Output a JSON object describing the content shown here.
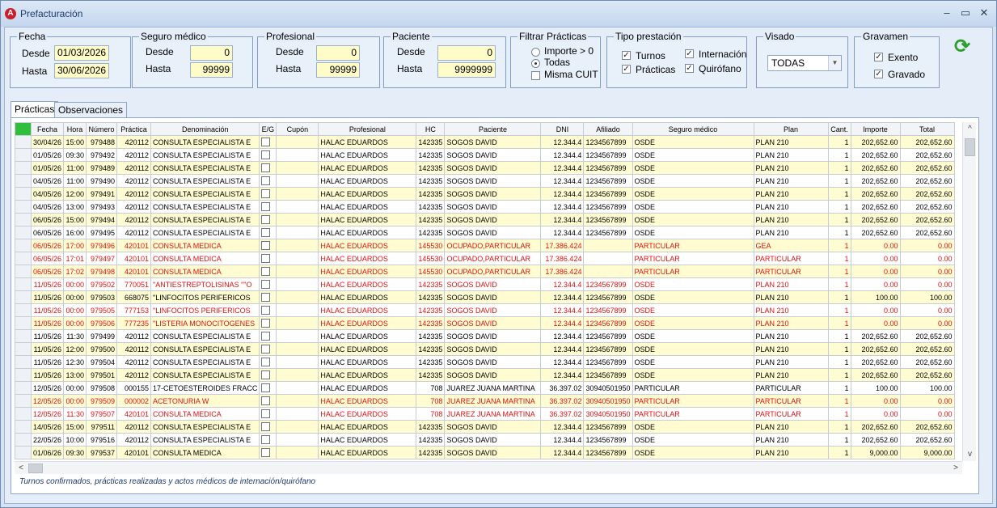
{
  "window": {
    "title": "Prefacturación",
    "minimize": "–",
    "maximize": "▭",
    "close": "✕"
  },
  "filters": {
    "fecha": {
      "label": "Fecha",
      "desde_label": "Desde",
      "desde": "01/03/2026",
      "hasta_label": "Hasta",
      "hasta": "30/06/2026"
    },
    "seguro": {
      "label": "Seguro médico",
      "desde_label": "Desde",
      "desde": "0",
      "hasta_label": "Hasta",
      "hasta": "99999"
    },
    "profesional": {
      "label": "Profesional",
      "desde_label": "Desde",
      "desde": "0",
      "hasta_label": "Hasta",
      "hasta": "99999"
    },
    "paciente": {
      "label": "Paciente",
      "desde_label": "Desde",
      "desde": "0",
      "hasta_label": "Hasta",
      "hasta": "9999999"
    },
    "practicas": {
      "label": "Filtrar Prácticas",
      "importe": "Importe > 0",
      "todas": "Todas",
      "misma_cuit": "Misma CUIT"
    },
    "tipo": {
      "label": "Tipo prestación",
      "turnos": "Turnos",
      "practicas": "Prácticas",
      "internacion": "Internación",
      "quirofano": "Quirófano"
    },
    "visado": {
      "label": "Visado",
      "value": "TODAS"
    },
    "gravamen": {
      "label": "Gravamen",
      "exento": "Exento",
      "gravado": "Gravado"
    }
  },
  "tabs": [
    {
      "label": "Prácticas"
    },
    {
      "label": "Observaciones"
    }
  ],
  "columns": [
    "Fecha",
    "Hora",
    "Número",
    "Práctica",
    "Denominación",
    "E/G",
    "Cupón",
    "Profesional",
    "HC",
    "Paciente",
    "DNI",
    "Afiliado",
    "Seguro médico",
    "Plan",
    "Cant.",
    "Importe",
    "Total"
  ],
  "rows": [
    {
      "fecha": "30/04/26",
      "hora": "15:00",
      "numero": "979488",
      "practica": "420112",
      "denom": "CONSULTA ESPECIALISTA E",
      "cupon": "",
      "prof": "HALAC EDUARDOS",
      "hc": "142335",
      "paciente": "SOGOS DAVID",
      "dni": "12.344.4",
      "afiliado": "1234567899",
      "seguro": "OSDE",
      "plan": "PLAN 210",
      "cant": "1",
      "importe": "202,652.60",
      "total": "202,652.60",
      "style": "y"
    },
    {
      "fecha": "01/05/26",
      "hora": "09:30",
      "numero": "979492",
      "practica": "420112",
      "denom": "CONSULTA ESPECIALISTA E",
      "cupon": "",
      "prof": "HALAC EDUARDOS",
      "hc": "142335",
      "paciente": "SOGOS DAVID",
      "dni": "12.344.4",
      "afiliado": "1234567899",
      "seguro": "OSDE",
      "plan": "PLAN 210",
      "cant": "1",
      "importe": "202,652.60",
      "total": "202,652.60",
      "style": "w"
    },
    {
      "fecha": "01/05/26",
      "hora": "11:00",
      "numero": "979489",
      "practica": "420112",
      "denom": "CONSULTA ESPECIALISTA E",
      "cupon": "",
      "prof": "HALAC EDUARDOS",
      "hc": "142335",
      "paciente": "SOGOS DAVID",
      "dni": "12.344.4",
      "afiliado": "1234567899",
      "seguro": "OSDE",
      "plan": "PLAN 210",
      "cant": "1",
      "importe": "202,652.60",
      "total": "202,652.60",
      "style": "y"
    },
    {
      "fecha": "04/05/26",
      "hora": "11:00",
      "numero": "979490",
      "practica": "420112",
      "denom": "CONSULTA ESPECIALISTA E",
      "cupon": "",
      "prof": "HALAC EDUARDOS",
      "hc": "142335",
      "paciente": "SOGOS DAVID",
      "dni": "12.344.4",
      "afiliado": "1234567899",
      "seguro": "OSDE",
      "plan": "PLAN 210",
      "cant": "1",
      "importe": "202,652.60",
      "total": "202,652.60",
      "style": "w"
    },
    {
      "fecha": "04/05/26",
      "hora": "12:00",
      "numero": "979491",
      "practica": "420112",
      "denom": "CONSULTA ESPECIALISTA E",
      "cupon": "",
      "prof": "HALAC EDUARDOS",
      "hc": "142335",
      "paciente": "SOGOS DAVID",
      "dni": "12.344.4",
      "afiliado": "1234567899",
      "seguro": "OSDE",
      "plan": "PLAN 210",
      "cant": "1",
      "importe": "202,652.60",
      "total": "202,652.60",
      "style": "y"
    },
    {
      "fecha": "04/05/26",
      "hora": "13:00",
      "numero": "979493",
      "practica": "420112",
      "denom": "CONSULTA ESPECIALISTA E",
      "cupon": "",
      "prof": "HALAC EDUARDOS",
      "hc": "142335",
      "paciente": "SOGOS DAVID",
      "dni": "12.344.4",
      "afiliado": "1234567899",
      "seguro": "OSDE",
      "plan": "PLAN 210",
      "cant": "1",
      "importe": "202,652.60",
      "total": "202,652.60",
      "style": "w"
    },
    {
      "fecha": "06/05/26",
      "hora": "15:00",
      "numero": "979494",
      "practica": "420112",
      "denom": "CONSULTA ESPECIALISTA E",
      "cupon": "",
      "prof": "HALAC EDUARDOS",
      "hc": "142335",
      "paciente": "SOGOS DAVID",
      "dni": "12.344.4",
      "afiliado": "1234567899",
      "seguro": "OSDE",
      "plan": "PLAN 210",
      "cant": "1",
      "importe": "202,652.60",
      "total": "202,652.60",
      "style": "y"
    },
    {
      "fecha": "06/05/26",
      "hora": "16:00",
      "numero": "979495",
      "practica": "420112",
      "denom": "CONSULTA ESPECIALISTA E",
      "cupon": "",
      "prof": "HALAC EDUARDOS",
      "hc": "142335",
      "paciente": "SOGOS DAVID",
      "dni": "12.344.4",
      "afiliado": "1234567899",
      "seguro": "OSDE",
      "plan": "PLAN 210",
      "cant": "1",
      "importe": "202,652.60",
      "total": "202,652.60",
      "style": "w"
    },
    {
      "fecha": "06/05/26",
      "hora": "17:00",
      "numero": "979496",
      "practica": "420101",
      "denom": "CONSULTA MEDICA",
      "cupon": "",
      "prof": "HALAC EDUARDOS",
      "hc": "145530",
      "paciente": "OCUPADO,PARTICULAR",
      "dni": "17.386.424",
      "afiliado": "",
      "seguro": "PARTICULAR",
      "plan": "GEA",
      "cant": "1",
      "importe": "0.00",
      "total": "0.00",
      "style": "y red"
    },
    {
      "fecha": "06/05/26",
      "hora": "17:01",
      "numero": "979497",
      "practica": "420101",
      "denom": "CONSULTA MEDICA",
      "cupon": "",
      "prof": "HALAC EDUARDOS",
      "hc": "145530",
      "paciente": "OCUPADO,PARTICULAR",
      "dni": "17.386.424",
      "afiliado": "",
      "seguro": "PARTICULAR",
      "plan": "PARTICULAR",
      "cant": "1",
      "importe": "0.00",
      "total": "0.00",
      "style": "w red"
    },
    {
      "fecha": "06/05/26",
      "hora": "17:02",
      "numero": "979498",
      "practica": "420101",
      "denom": "CONSULTA MEDICA",
      "cupon": "",
      "prof": "HALAC EDUARDOS",
      "hc": "145530",
      "paciente": "OCUPADO,PARTICULAR",
      "dni": "17.386.424",
      "afiliado": "",
      "seguro": "PARTICULAR",
      "plan": "PARTICULAR",
      "cant": "1",
      "importe": "0.00",
      "total": "0.00",
      "style": "y red"
    },
    {
      "fecha": "11/05/26",
      "hora": "00:00",
      "numero": "979502",
      "practica": "770051",
      "denom": "\"ANTIESTREPTOLISINAS \"\"O",
      "cupon": "",
      "prof": "HALAC EDUARDOS",
      "hc": "142335",
      "paciente": "SOGOS DAVID",
      "dni": "12.344.4",
      "afiliado": "1234567899",
      "seguro": "OSDE",
      "plan": "PLAN 210",
      "cant": "1",
      "importe": "0.00",
      "total": "0.00",
      "style": "w red"
    },
    {
      "fecha": "11/05/26",
      "hora": "00:00",
      "numero": "979503",
      "practica": "668075",
      "denom": "\"LINFOCITOS PERIFERICOS",
      "cupon": "",
      "prof": "HALAC EDUARDOS",
      "hc": "142335",
      "paciente": "SOGOS DAVID",
      "dni": "12.344.4",
      "afiliado": "1234567899",
      "seguro": "OSDE",
      "plan": "PLAN 210",
      "cant": "1",
      "importe": "100.00",
      "total": "100.00",
      "style": "y"
    },
    {
      "fecha": "11/05/26",
      "hora": "00:00",
      "numero": "979505",
      "practica": "777153",
      "denom": "\"LINFOCITOS PERIFERICOS",
      "cupon": "",
      "prof": "HALAC EDUARDOS",
      "hc": "142335",
      "paciente": "SOGOS DAVID",
      "dni": "12.344.4",
      "afiliado": "1234567899",
      "seguro": "OSDE",
      "plan": "PLAN 210",
      "cant": "1",
      "importe": "0.00",
      "total": "0.00",
      "style": "w red"
    },
    {
      "fecha": "11/05/26",
      "hora": "00:00",
      "numero": "979506",
      "practica": "777235",
      "denom": "\"LISTERIA MONOCITOGENES",
      "cupon": "",
      "prof": "HALAC EDUARDOS",
      "hc": "142335",
      "paciente": "SOGOS DAVID",
      "dni": "12.344.4",
      "afiliado": "1234567899",
      "seguro": "OSDE",
      "plan": "PLAN 210",
      "cant": "1",
      "importe": "0.00",
      "total": "0.00",
      "style": "y red"
    },
    {
      "fecha": "11/05/26",
      "hora": "11:30",
      "numero": "979499",
      "practica": "420112",
      "denom": "CONSULTA ESPECIALISTA E",
      "cupon": "",
      "prof": "HALAC EDUARDOS",
      "hc": "142335",
      "paciente": "SOGOS DAVID",
      "dni": "12.344.4",
      "afiliado": "1234567899",
      "seguro": "OSDE",
      "plan": "PLAN 210",
      "cant": "1",
      "importe": "202,652.60",
      "total": "202,652.60",
      "style": "w"
    },
    {
      "fecha": "11/05/26",
      "hora": "12:00",
      "numero": "979500",
      "practica": "420112",
      "denom": "CONSULTA ESPECIALISTA E",
      "cupon": "",
      "prof": "HALAC EDUARDOS",
      "hc": "142335",
      "paciente": "SOGOS DAVID",
      "dni": "12.344.4",
      "afiliado": "1234567899",
      "seguro": "OSDE",
      "plan": "PLAN 210",
      "cant": "1",
      "importe": "202,652.60",
      "total": "202,652.60",
      "style": "y"
    },
    {
      "fecha": "11/05/26",
      "hora": "12:30",
      "numero": "979504",
      "practica": "420112",
      "denom": "CONSULTA ESPECIALISTA E",
      "cupon": "",
      "prof": "HALAC EDUARDOS",
      "hc": "142335",
      "paciente": "SOGOS DAVID",
      "dni": "12.344.4",
      "afiliado": "1234567899",
      "seguro": "OSDE",
      "plan": "PLAN 210",
      "cant": "1",
      "importe": "202,652.60",
      "total": "202,652.60",
      "style": "w"
    },
    {
      "fecha": "11/05/26",
      "hora": "13:00",
      "numero": "979501",
      "practica": "420112",
      "denom": "CONSULTA ESPECIALISTA E",
      "cupon": "",
      "prof": "HALAC EDUARDOS",
      "hc": "142335",
      "paciente": "SOGOS DAVID",
      "dni": "12.344.4",
      "afiliado": "1234567899",
      "seguro": "OSDE",
      "plan": "PLAN 210",
      "cant": "1",
      "importe": "202,652.60",
      "total": "202,652.60",
      "style": "y"
    },
    {
      "fecha": "12/05/26",
      "hora": "00:00",
      "numero": "979508",
      "practica": "000155",
      "denom": "17-CETOESTEROIDES FRACC",
      "cupon": "",
      "prof": "HALAC EDUARDOS",
      "hc": "708",
      "paciente": "JUAREZ JUANA MARTINA",
      "dni": "36.397.02",
      "afiliado": "30940501950",
      "seguro": "PARTICULAR",
      "plan": "PARTICULAR",
      "cant": "1",
      "importe": "100.00",
      "total": "100.00",
      "style": "w"
    },
    {
      "fecha": "12/05/26",
      "hora": "00:00",
      "numero": "979509",
      "practica": "000002",
      "denom": "ACETONURIA W",
      "cupon": "",
      "prof": "HALAC EDUARDOS",
      "hc": "708",
      "paciente": "JUAREZ JUANA MARTINA",
      "dni": "36.397.02",
      "afiliado": "30940501950",
      "seguro": "PARTICULAR",
      "plan": "PARTICULAR",
      "cant": "1",
      "importe": "0.00",
      "total": "0.00",
      "style": "y red"
    },
    {
      "fecha": "12/05/26",
      "hora": "11:30",
      "numero": "979507",
      "practica": "420101",
      "denom": "CONSULTA MEDICA",
      "cupon": "",
      "prof": "HALAC EDUARDOS",
      "hc": "708",
      "paciente": "JUAREZ JUANA MARTINA",
      "dni": "36.397.02",
      "afiliado": "30940501950",
      "seguro": "PARTICULAR",
      "plan": "PARTICULAR",
      "cant": "1",
      "importe": "0.00",
      "total": "0.00",
      "style": "w red"
    },
    {
      "fecha": "14/05/26",
      "hora": "15:00",
      "numero": "979511",
      "practica": "420112",
      "denom": "CONSULTA ESPECIALISTA E",
      "cupon": "",
      "prof": "HALAC EDUARDOS",
      "hc": "142335",
      "paciente": "SOGOS DAVID",
      "dni": "12.344.4",
      "afiliado": "1234567899",
      "seguro": "OSDE",
      "plan": "PLAN 210",
      "cant": "1",
      "importe": "202,652.60",
      "total": "202,652.60",
      "style": "y"
    },
    {
      "fecha": "22/05/26",
      "hora": "10:00",
      "numero": "979516",
      "practica": "420112",
      "denom": "CONSULTA ESPECIALISTA E",
      "cupon": "",
      "prof": "HALAC EDUARDOS",
      "hc": "142335",
      "paciente": "SOGOS DAVID",
      "dni": "12.344.4",
      "afiliado": "1234567899",
      "seguro": "OSDE",
      "plan": "PLAN 210",
      "cant": "1",
      "importe": "202,652.60",
      "total": "202,652.60",
      "style": "w"
    },
    {
      "fecha": "01/06/26",
      "hora": "09:30",
      "numero": "979537",
      "practica": "420101",
      "denom": "CONSULTA MEDICA",
      "cupon": "",
      "prof": "HALAC EDUARDOS",
      "hc": "142335",
      "paciente": "SOGOS DAVID",
      "dni": "12.344.4",
      "afiliado": "1234567899",
      "seguro": "OSDE",
      "plan": "PLAN 210",
      "cant": "1",
      "importe": "9,000.00",
      "total": "9,000.00",
      "style": "y"
    }
  ],
  "footer": "Turnos confirmados, prácticas realizadas y actos médicos de internación/quirófano",
  "icons": {
    "refresh": "refresh-icon",
    "app": "app-logo-icon"
  },
  "colors": {
    "row_yellow": "#fffcd2",
    "row_red_text": "#e01010",
    "indicator": "#2fbf3a"
  }
}
